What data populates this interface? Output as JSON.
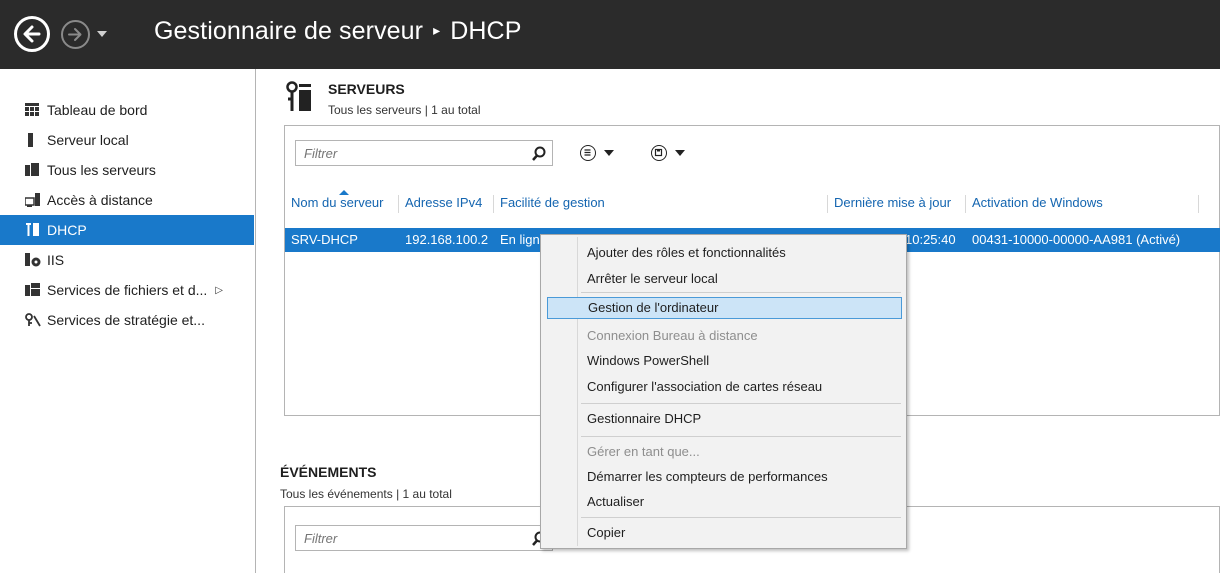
{
  "window": {
    "title": "Gestionnaire de serveur",
    "breadcrumb_sep": "▸",
    "breadcrumb_current": "DHCP"
  },
  "sidebar": {
    "items": [
      {
        "label": "Tableau de bord",
        "icon": "dashboard-icon"
      },
      {
        "label": "Serveur local",
        "icon": "server-icon"
      },
      {
        "label": "Tous les serveurs",
        "icon": "servers-icon"
      },
      {
        "label": "Accès à distance",
        "icon": "remote-access-icon"
      },
      {
        "label": "DHCP",
        "icon": "dhcp-icon",
        "active": true
      },
      {
        "label": "IIS",
        "icon": "iis-icon"
      },
      {
        "label": "Services de fichiers et d...",
        "icon": "file-services-icon",
        "expand": "▷"
      },
      {
        "label": "Services de stratégie et...",
        "icon": "policy-services-icon"
      }
    ]
  },
  "servers": {
    "title": "SERVEURS",
    "subtitle": "Tous les serveurs | 1 au total",
    "filter_placeholder": "Filtrer",
    "columns": [
      "Nom du serveur",
      "Adresse IPv4",
      "Facilité de gestion",
      "Dernière mise à jour",
      "Activation de Windows"
    ],
    "row": {
      "name": "SRV-DHCP",
      "ipv4": "192.168.100.2",
      "manageability": "En lign",
      "last_update": "10:25:40",
      "activation": "00431-10000-00000-AA981 (Activé)"
    }
  },
  "events": {
    "title": "ÉVÉNEMENTS",
    "subtitle": "Tous les événements | 1 au total",
    "filter_placeholder": "Filtrer"
  },
  "context_menu": {
    "items": [
      {
        "label": "Ajouter des rôles et fonctionnalités"
      },
      {
        "label": "Arrêter le serveur local"
      },
      {
        "label": "Gestion de l'ordinateur",
        "hover": true
      },
      {
        "label": "Connexion Bureau à distance",
        "disabled": true
      },
      {
        "label": "Windows PowerShell"
      },
      {
        "label": "Configurer l'association de cartes réseau"
      },
      {
        "label": "Gestionnaire DHCP"
      },
      {
        "label": "Gérer en tant que...",
        "disabled": true
      },
      {
        "label": "Démarrer les compteurs de performances"
      },
      {
        "label": "Actualiser"
      },
      {
        "label": "Copier"
      }
    ]
  },
  "colors": {
    "titlebar": "#2b2b2b",
    "accent": "#1979ca",
    "header_link": "#1465b0",
    "menu_hover": "#cce4f7"
  }
}
